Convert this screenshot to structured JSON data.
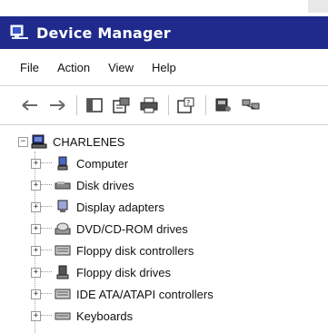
{
  "window": {
    "title": "Device Manager"
  },
  "menu": {
    "items": [
      "File",
      "Action",
      "View",
      "Help"
    ]
  },
  "toolbar": {
    "buttons": [
      "back-arrow-icon",
      "forward-arrow-icon",
      "show-hide-tree-icon",
      "properties-icon",
      "print-icon",
      "help-icon",
      "scan-hardware-icon",
      "network-icon"
    ]
  },
  "tree": {
    "root": {
      "label": "CHARLENES",
      "expanded": true,
      "icon": "computer-icon"
    },
    "children": [
      {
        "label": "Computer",
        "icon": "computer-icon"
      },
      {
        "label": "Disk drives",
        "icon": "disk-drive-icon"
      },
      {
        "label": "Display adapters",
        "icon": "display-adapter-icon"
      },
      {
        "label": "DVD/CD-ROM drives",
        "icon": "cdrom-icon"
      },
      {
        "label": "Floppy disk controllers",
        "icon": "controller-icon"
      },
      {
        "label": "Floppy disk drives",
        "icon": "floppy-icon"
      },
      {
        "label": "IDE ATA/ATAPI controllers",
        "icon": "controller-icon"
      },
      {
        "label": "Keyboards",
        "icon": "keyboard-icon"
      }
    ]
  }
}
